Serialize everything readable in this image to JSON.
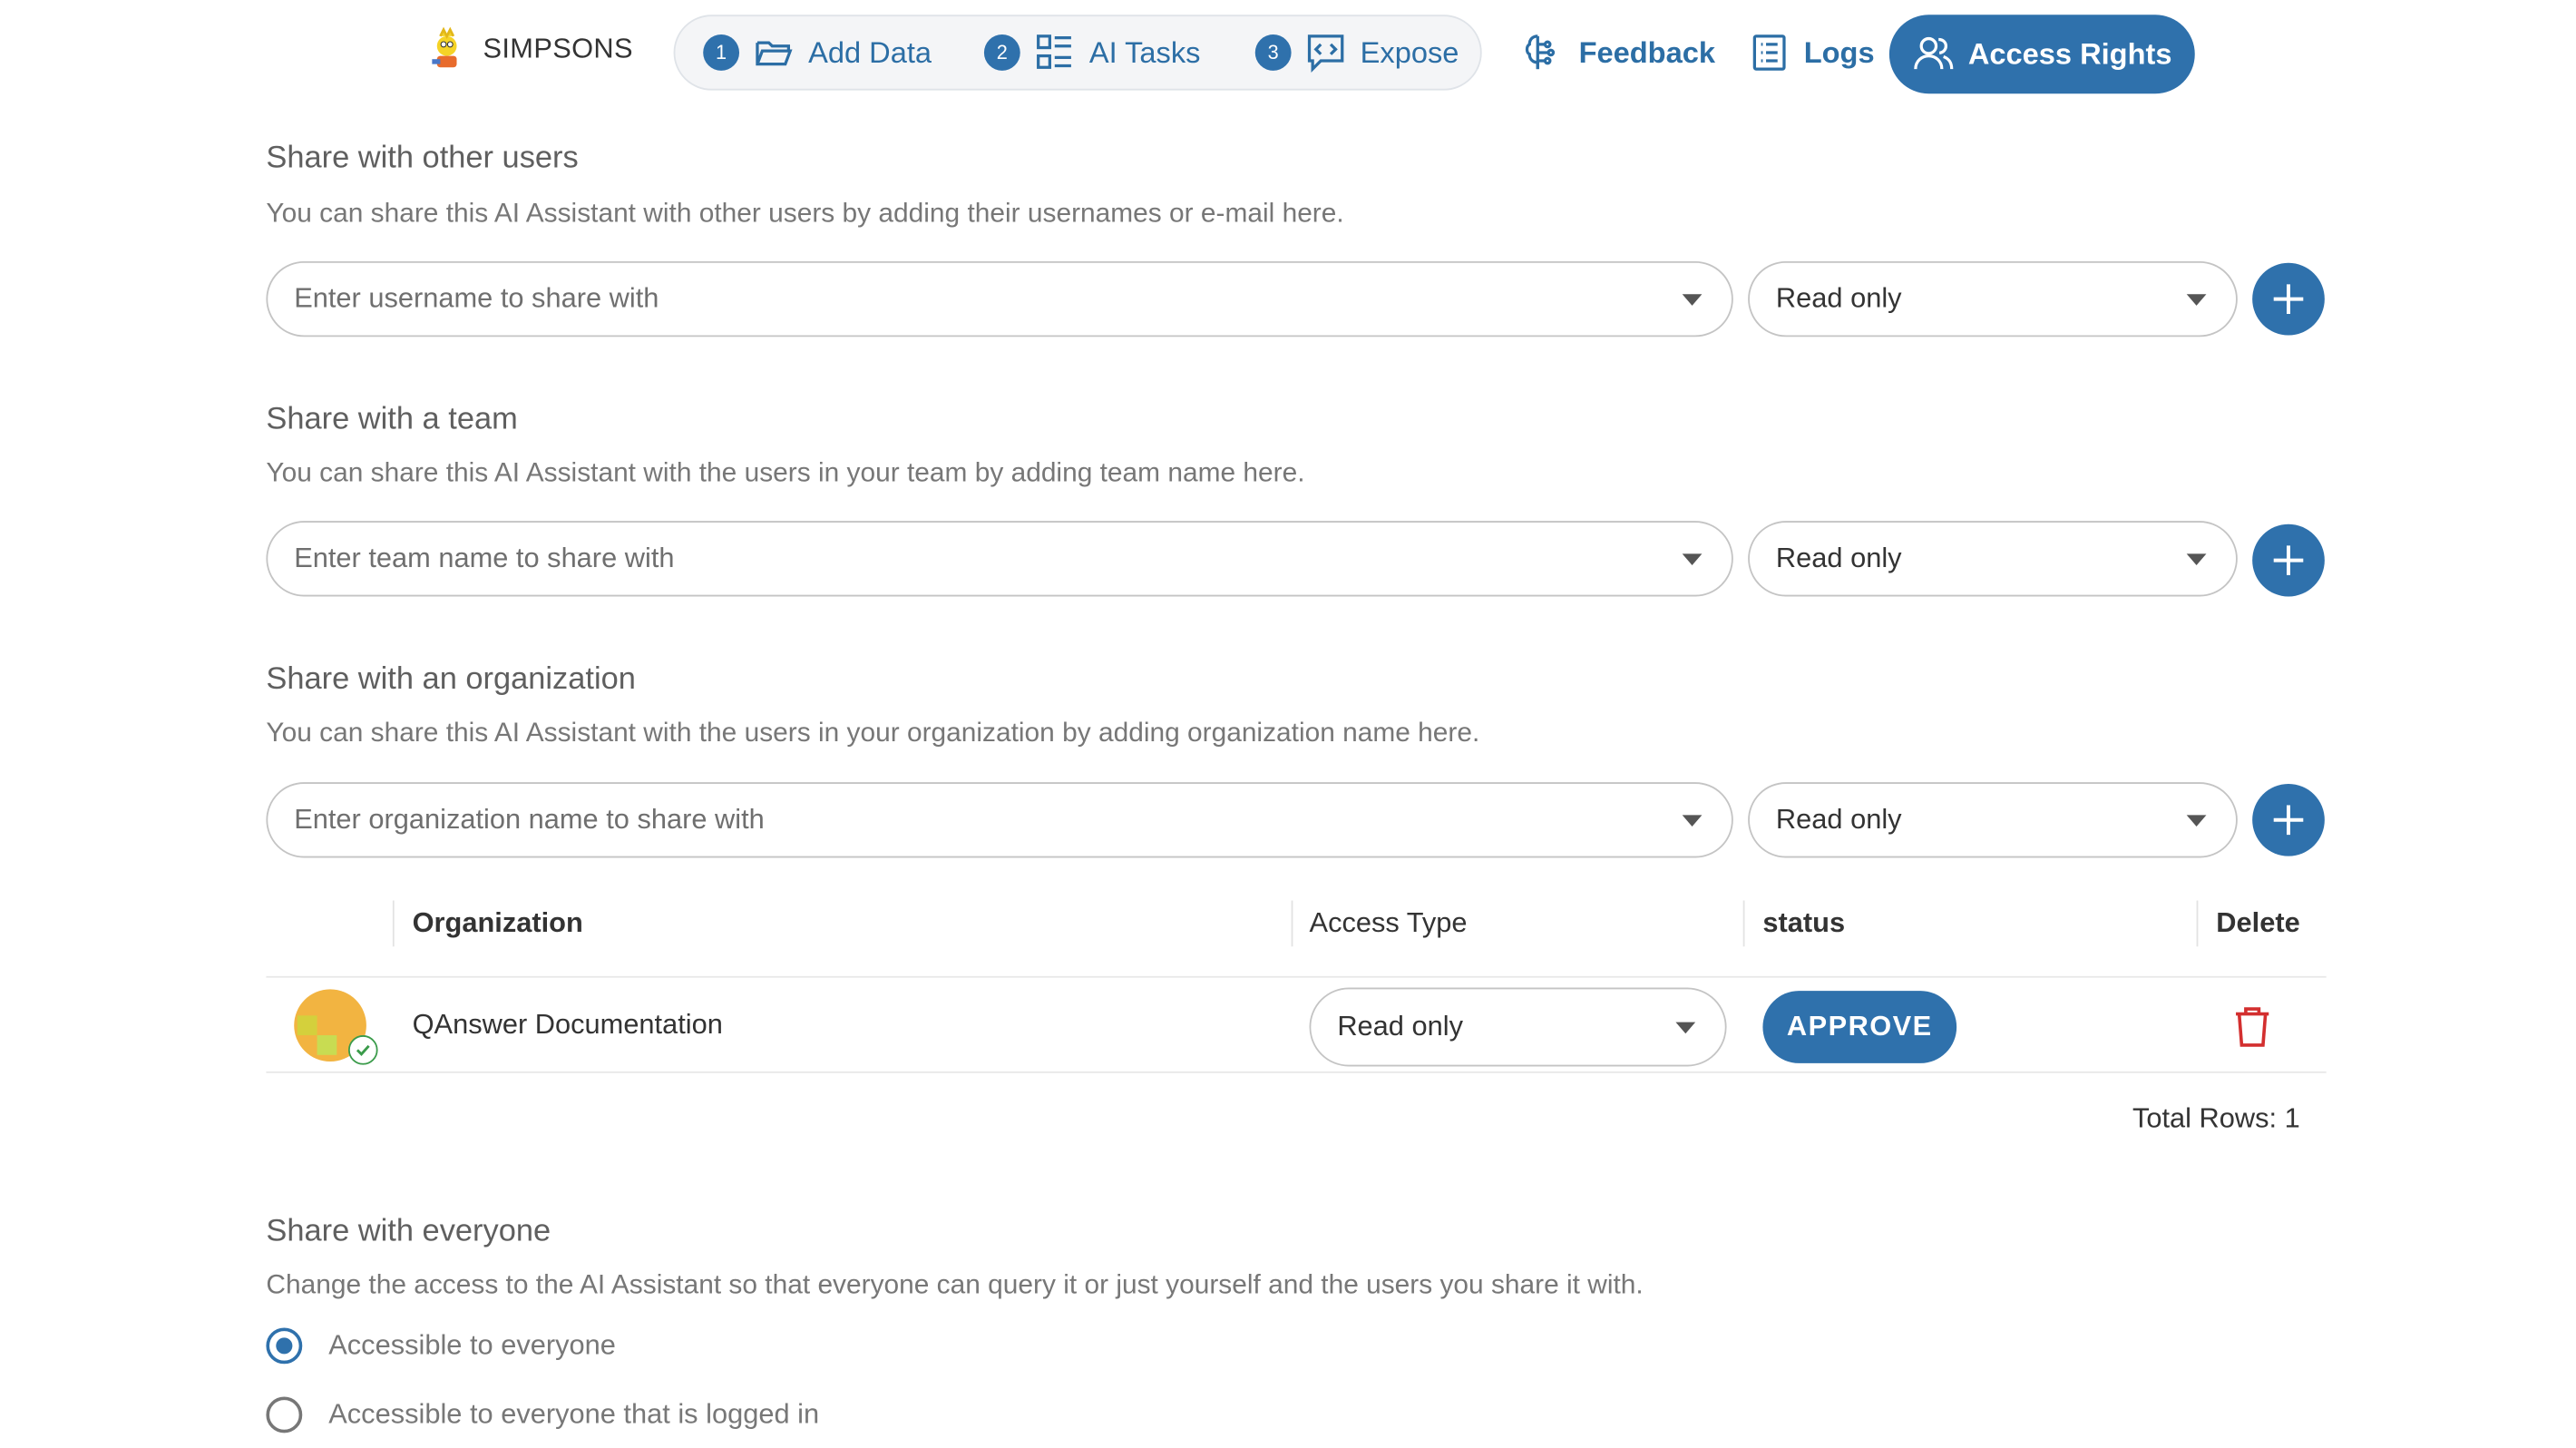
{
  "brand": {
    "name": "SIMPSONS"
  },
  "nav": {
    "steps": [
      {
        "num": "1",
        "label": "Add Data"
      },
      {
        "num": "2",
        "label": "AI Tasks"
      },
      {
        "num": "3",
        "label": "Expose"
      }
    ],
    "feedback": "Feedback",
    "logs": "Logs",
    "access_rights": "Access Rights"
  },
  "share_users": {
    "title": "Share with other users",
    "description": "You can share this AI Assistant with other users by adding their usernames or e-mail here.",
    "placeholder": "Enter username to share with",
    "access": "Read only"
  },
  "share_team": {
    "title": "Share with a team",
    "description": "You can share this AI Assistant with the users in your team by adding team name here.",
    "placeholder": "Enter team name to share with",
    "access": "Read only"
  },
  "share_org": {
    "title": "Share with an organization",
    "description": "You can share this AI Assistant with the users in your organization by adding organization name here.",
    "placeholder": "Enter organization name to share with",
    "access": "Read only"
  },
  "table": {
    "headers": {
      "organization": "Organization",
      "access_type": "Access Type",
      "status": "status",
      "delete": "Delete"
    },
    "rows": [
      {
        "organization": "QAnswer Documentation",
        "access_type": "Read only",
        "status_action": "APPROVE"
      }
    ],
    "total_rows": "Total Rows: 1"
  },
  "share_everyone": {
    "title": "Share with everyone",
    "description": "Change the access to the AI Assistant so that everyone can query it or just yourself and the users you share it with.",
    "options": [
      {
        "label": "Accessible to everyone",
        "checked": true
      },
      {
        "label": "Accessible to everyone that is logged in",
        "checked": false
      }
    ]
  },
  "colors": {
    "primary": "#2f71ac",
    "delete": "#d32f2f",
    "success": "#3a9b4a"
  }
}
